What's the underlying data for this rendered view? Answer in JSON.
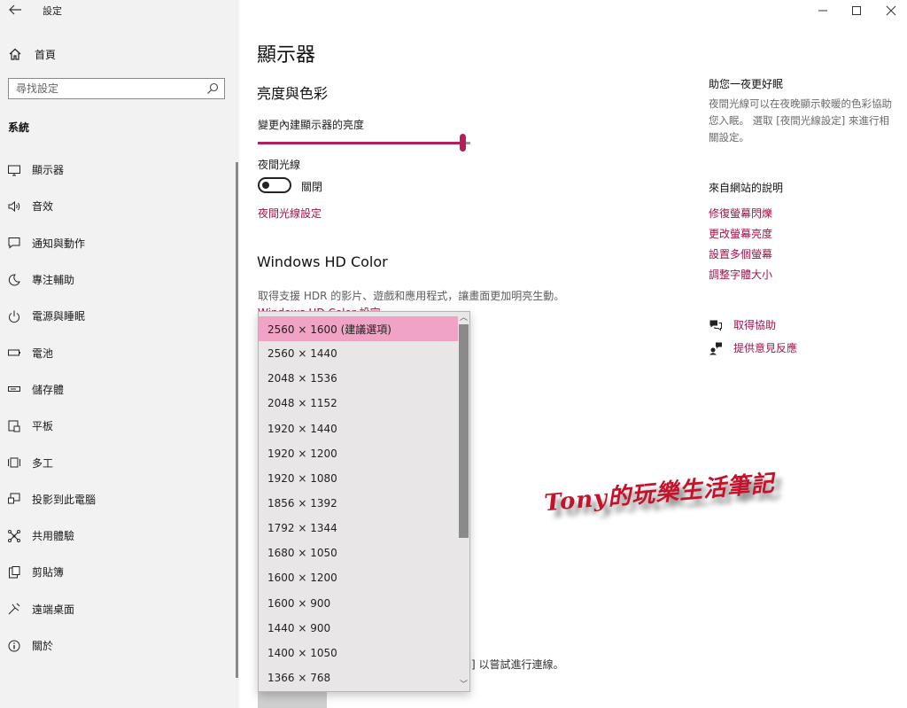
{
  "window": {
    "title": "設定"
  },
  "sidebar": {
    "home": "首頁",
    "search_placeholder": "尋找設定",
    "section": "系統",
    "items": [
      {
        "label": "顯示器",
        "icon": "monitor-icon"
      },
      {
        "label": "音效",
        "icon": "speaker-icon"
      },
      {
        "label": "通知與動作",
        "icon": "notification-icon"
      },
      {
        "label": "專注輔助",
        "icon": "moon-icon"
      },
      {
        "label": "電源與睡眠",
        "icon": "power-icon"
      },
      {
        "label": "電池",
        "icon": "battery-icon"
      },
      {
        "label": "儲存體",
        "icon": "storage-icon"
      },
      {
        "label": "平板",
        "icon": "tablet-icon"
      },
      {
        "label": "多工",
        "icon": "multitask-icon"
      },
      {
        "label": "投影到此電腦",
        "icon": "project-icon"
      },
      {
        "label": "共用體驗",
        "icon": "shared-icon"
      },
      {
        "label": "剪貼簿",
        "icon": "clipboard-icon"
      },
      {
        "label": "遠端桌面",
        "icon": "remote-icon"
      },
      {
        "label": "關於",
        "icon": "info-icon"
      }
    ]
  },
  "main": {
    "title": "顯示器",
    "brightness_heading": "亮度與色彩",
    "brightness_label": "變更內建顯示器的亮度",
    "brightness_value": 0.98,
    "night_light_label": "夜間光線",
    "night_light_state": "關閉",
    "night_light_link": "夜間光線設定",
    "hd_title": "Windows HD Color",
    "hd_desc": "取得支援 HDR 的影片、遊戲和應用程式，讓畫面更加明亮生動。",
    "hd_link": "Windows HD Color 設定",
    "bottom_text": "測] 以嘗試進行連線。"
  },
  "dropdown": {
    "selected_index": 0,
    "options": [
      "2560 × 1600 (建議選項)",
      "2560 × 1440",
      "2048 × 1536",
      "2048 × 1152",
      "1920 × 1440",
      "1920 × 1200",
      "1920 × 1080",
      "1856 × 1392",
      "1792 × 1344",
      "1680 × 1050",
      "1600 × 1200",
      "1600 × 900",
      "1440 × 900",
      "1400 × 1050",
      "1366 × 768"
    ]
  },
  "right_panel": {
    "sleep_title": "助您一夜更好眠",
    "sleep_desc": "夜間光線可以在夜晚顯示較暖的色彩協助您入眠。 選取 [夜間光線設定] 來進行相關設定。",
    "web_help_title": "來自網站的說明",
    "links": [
      "修復螢幕閃爍",
      "更改螢幕亮度",
      "設置多個螢幕",
      "調整字體大小"
    ],
    "get_help": "取得協助",
    "feedback": "提供意見反應"
  },
  "watermark": "Tony的玩樂生活筆記",
  "colors": {
    "accent": "#b41e5a",
    "link": "#a0134b",
    "selection": "#f0a3c4"
  }
}
